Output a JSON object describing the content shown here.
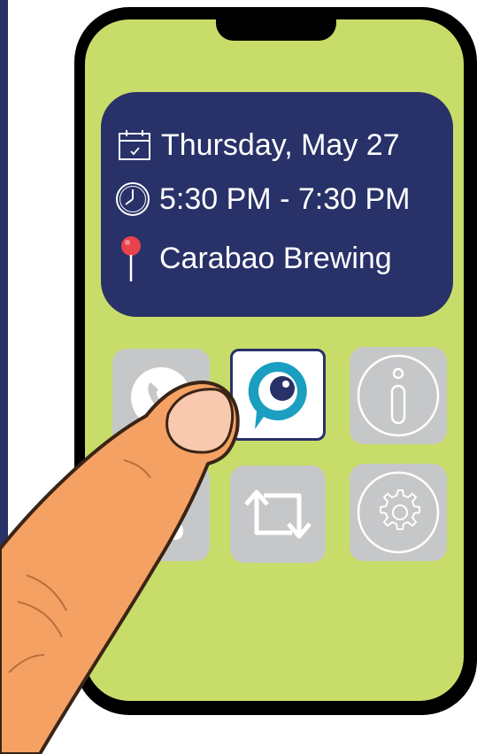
{
  "event": {
    "date": "Thursday, May 27",
    "time": "5:30 PM - 7:30 PM",
    "location": "Carabao Brewing"
  },
  "icons": {
    "date": "calendar-icon",
    "time": "clock-icon",
    "location": "map-pin-icon"
  },
  "apps": [
    {
      "name": "phone",
      "icon": "phone-icon",
      "selected": false
    },
    {
      "name": "chat-eye-app",
      "icon": "chat-eye-icon",
      "selected": true
    },
    {
      "name": "info",
      "icon": "info-icon",
      "selected": false
    },
    {
      "name": "messages",
      "icon": "chat-bubble-icon",
      "selected": false
    },
    {
      "name": "repost",
      "icon": "repost-icon",
      "selected": false
    },
    {
      "name": "settings",
      "icon": "gear-icon",
      "selected": false
    }
  ],
  "colors": {
    "navy": "#283168",
    "screen": "#c8dd69",
    "tile": "#c6c7c8",
    "accent_cyan": "#1a9fc0",
    "pin_red": "#e8434a",
    "finger": "#f4a163"
  }
}
